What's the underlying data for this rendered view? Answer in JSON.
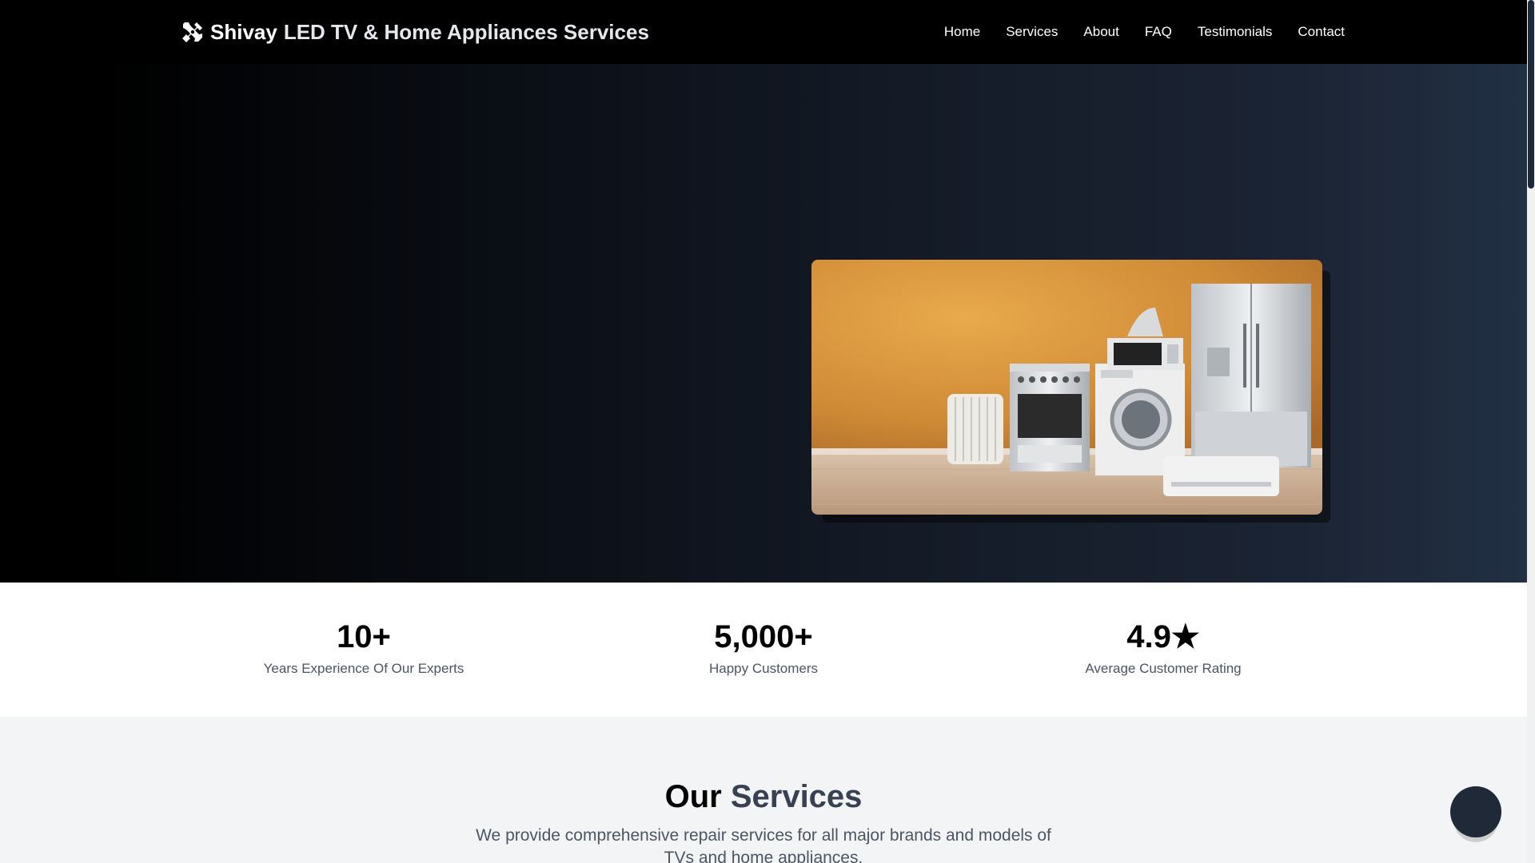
{
  "nav": {
    "brand_first": "Shivay",
    "brand_rest": "LED TV & Home Appliances Services",
    "brand_icon": "tools-icon",
    "links": [
      {
        "label": "Home"
      },
      {
        "label": "Services"
      },
      {
        "label": "About"
      },
      {
        "label": "FAQ"
      },
      {
        "label": "Testimonials"
      },
      {
        "label": "Contact"
      }
    ]
  },
  "hero": {
    "image_subject": "home-appliances-photo"
  },
  "stats": [
    {
      "value": "10+",
      "label": "Years Experience Of Our Experts"
    },
    {
      "value": "5,000+",
      "label": "Happy Customers"
    },
    {
      "value": "4.9★",
      "label": "Average Customer Rating"
    }
  ],
  "services": {
    "title_part1": "Our",
    "title_part2": "Services",
    "description": "We provide comprehensive repair services for all major brands and models of TVs and home appliances."
  },
  "colors": {
    "nav_bg": "#000000",
    "accent_dark": "#1f2937",
    "title_accent": "#374151",
    "muted_text": "#4b5563",
    "section_bg": "#f3f4f6"
  }
}
